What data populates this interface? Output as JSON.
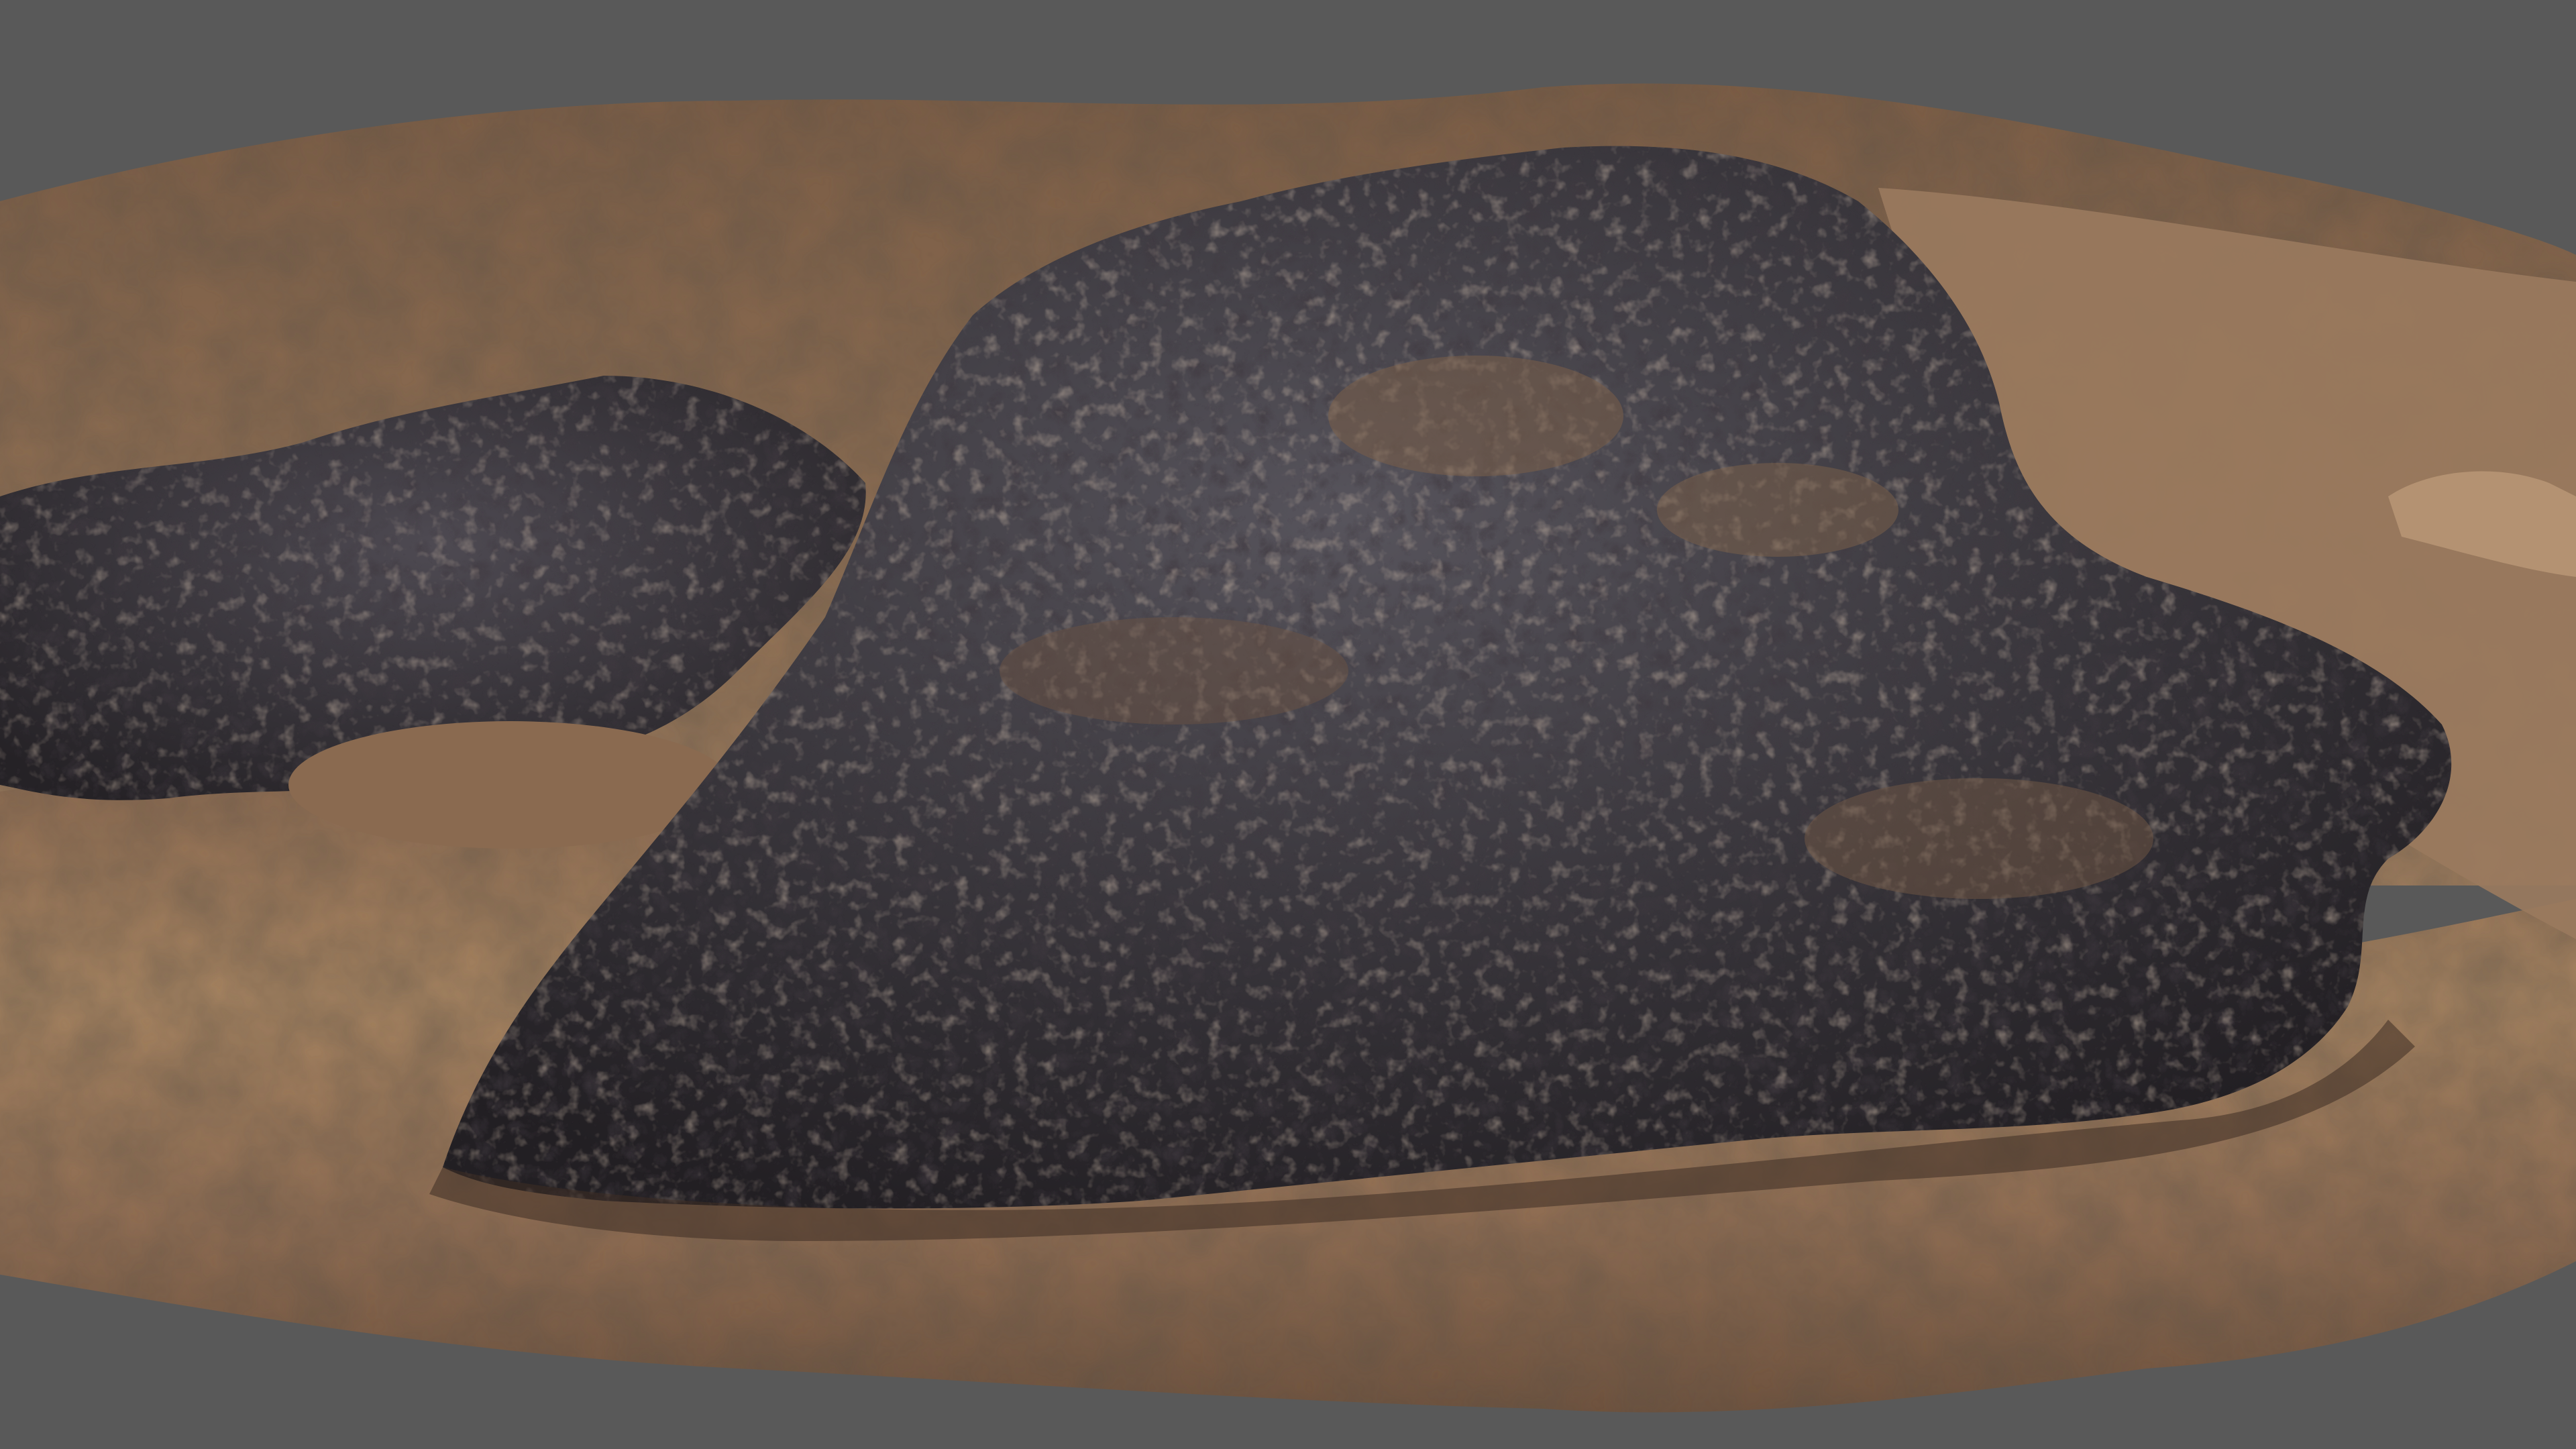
{
  "viewport": {
    "background_color": "#595959",
    "subject": "scanned-terrain-mesh"
  },
  "colors": {
    "sand_light": "#b08a6a",
    "sand_mid": "#8c6a4e",
    "sand_dark": "#4e3a2c",
    "rock_light": "#6b6670",
    "rock_mid": "#3d3a40",
    "rock_dark": "#1c1a1e"
  }
}
